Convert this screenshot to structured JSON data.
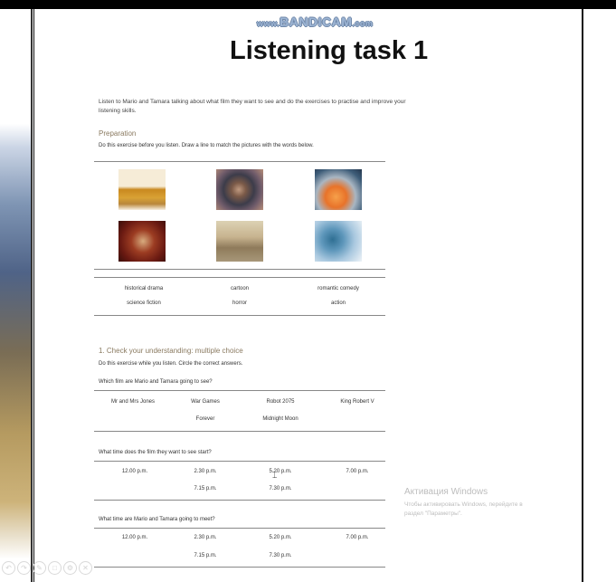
{
  "watermark": {
    "prefix": "www.",
    "brand": "BANDICAM",
    "suffix": ".com"
  },
  "document": {
    "title": "Listening task 1",
    "intro": "Listen to Mario and Tamara talking about what film they want to see and do the exercises to practise and improve your listening skills.",
    "preparation": {
      "heading": "Preparation",
      "instruction": "Do this exercise before you listen. Draw a line to match the pictures with the words below.",
      "pictures": [
        "historical-scene-image",
        "portrait-image",
        "fire-explosion-image",
        "drama-image",
        "forest-image",
        "scifi-image"
      ],
      "words": [
        "historical drama",
        "cartoon",
        "romantic comedy",
        "science fiction",
        "horror",
        "action"
      ]
    },
    "exercise1": {
      "heading": "1. Check your understanding: multiple choice",
      "instruction": "Do this exercise while you listen. Circle the correct answers.",
      "questions": [
        {
          "text": "Which film are Mario and Tamara going to see?",
          "row1": [
            "Mr and Mrs Jones",
            "War Games",
            "Robot 2075",
            "King Robert V"
          ],
          "row2": [
            "",
            "Forever",
            "Midnight Moon",
            ""
          ]
        },
        {
          "text": "What time does the film they want to see start?",
          "row1": [
            "12.00 p.m.",
            "2.30 p.m.",
            "5.20 p.m.",
            "7.00 p.m."
          ],
          "row2": [
            "",
            "7.15 p.m.",
            "7.30 p.m.",
            ""
          ]
        },
        {
          "text": "What time are Mario and Tamara going to meet?",
          "row1": [
            "12.00 p.m.",
            "2.30 p.m.",
            "5.20 p.m.",
            "7.00 p.m."
          ],
          "row2": [
            "",
            "7.15 p.m.",
            "7.30 p.m.",
            ""
          ]
        }
      ]
    }
  },
  "os_notice": {
    "heading": "Активация Windows",
    "line1": "Чтобы активировать Windows, перейдите в",
    "line2": "раздел \"Параметры\"."
  },
  "toolbar": {
    "icons": [
      "undo-icon",
      "redo-icon",
      "pen-icon",
      "eraser-icon",
      "settings-icon",
      "close-icon"
    ]
  },
  "colors": {
    "accent_heading": "#8a7a60",
    "watermark": "#9db5d4",
    "frame": "#000000"
  }
}
